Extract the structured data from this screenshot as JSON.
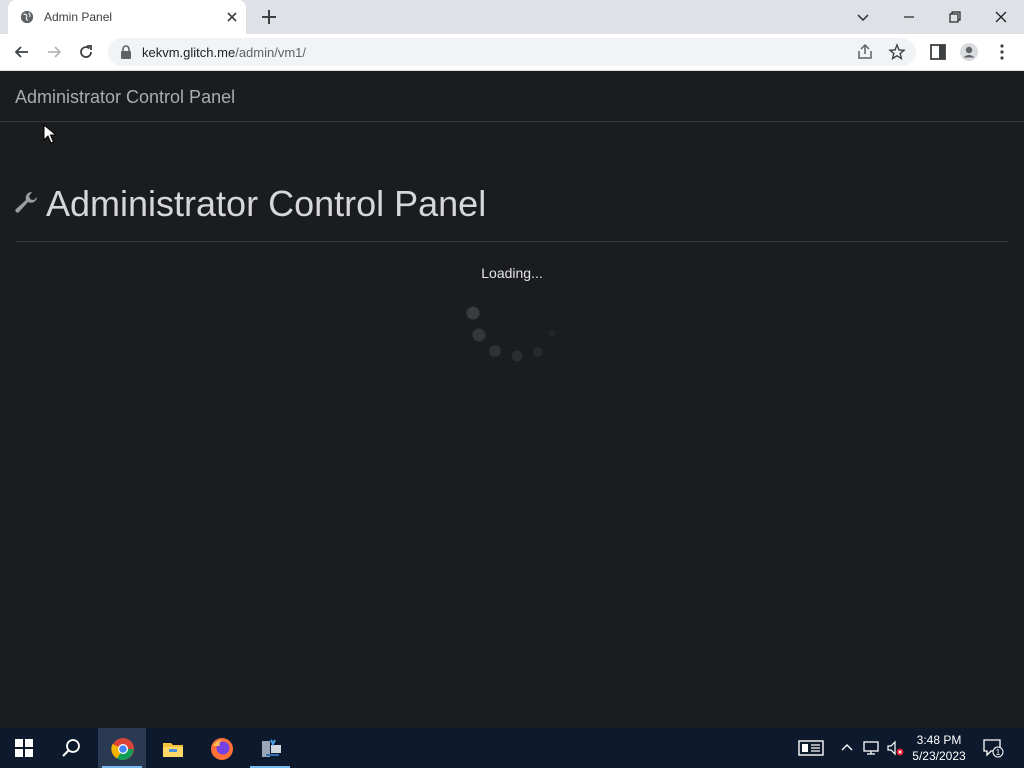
{
  "browser": {
    "tab_title": "Admin Panel",
    "url_host": "kekvm.glitch.me",
    "url_path": "/admin/vm1/"
  },
  "page": {
    "brand": "Administrator Control Panel",
    "heading": "Administrator Control Panel",
    "status": "Loading..."
  },
  "taskbar": {
    "apps": [
      "chrome-icon",
      "file-explorer-icon",
      "firefox-icon",
      "network-app-icon"
    ],
    "clock_time": "3:48 PM",
    "clock_date": "5/23/2023",
    "notifications_count": "1"
  },
  "colors": {
    "page_bg": "#1b1c1e",
    "taskbar_bg": "#0d1a2e",
    "tab_strip_bg": "#dee1e6"
  }
}
